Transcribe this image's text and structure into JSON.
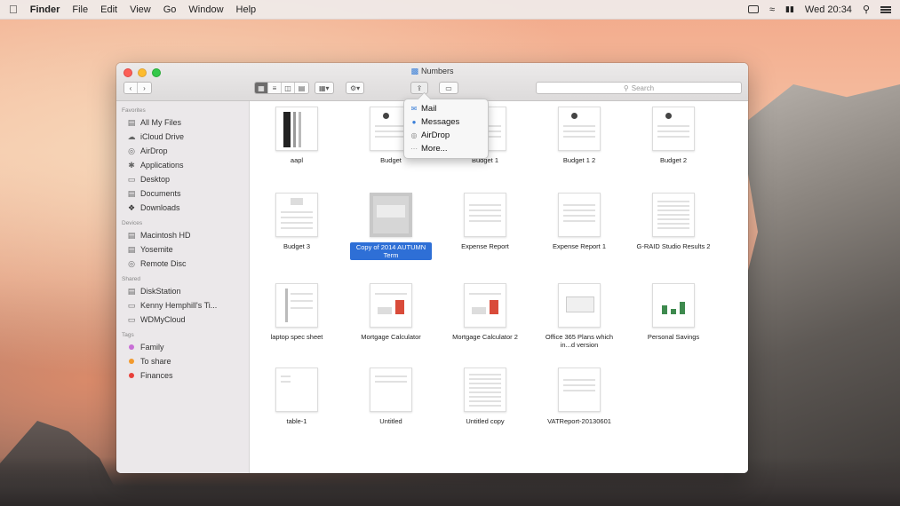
{
  "menubar": {
    "app_name": "Finder",
    "items": [
      "File",
      "Edit",
      "View",
      "Go",
      "Window",
      "Help"
    ],
    "clock": "Wed 20:34"
  },
  "window": {
    "title": "Numbers",
    "search_placeholder": "Search"
  },
  "sidebar": {
    "sections": [
      {
        "title": "Favorites",
        "items": [
          {
            "label": "All My Files",
            "icon": "all-files-icon"
          },
          {
            "label": "iCloud Drive",
            "icon": "cloud-icon"
          },
          {
            "label": "AirDrop",
            "icon": "airdrop-icon"
          },
          {
            "label": "Applications",
            "icon": "applications-icon"
          },
          {
            "label": "Desktop",
            "icon": "desktop-icon"
          },
          {
            "label": "Documents",
            "icon": "documents-icon"
          },
          {
            "label": "Downloads",
            "icon": "downloads-icon"
          }
        ]
      },
      {
        "title": "Devices",
        "items": [
          {
            "label": "Macintosh HD",
            "icon": "disk-icon"
          },
          {
            "label": "Yosemite",
            "icon": "disk-icon"
          },
          {
            "label": "Remote Disc",
            "icon": "disc-icon"
          }
        ]
      },
      {
        "title": "Shared",
        "items": [
          {
            "label": "DiskStation",
            "icon": "server-icon"
          },
          {
            "label": "Kenny Hemphill's Ti...",
            "icon": "server-icon"
          },
          {
            "label": "WDMyCloud",
            "icon": "server-icon"
          }
        ]
      },
      {
        "title": "Tags",
        "items": [
          {
            "label": "Family",
            "color": "#c86fd6"
          },
          {
            "label": "To share",
            "color": "#f29a2e"
          },
          {
            "label": "Finances",
            "color": "#e8403a"
          }
        ]
      }
    ]
  },
  "files": [
    {
      "name": "aapl"
    },
    {
      "name": "Budget"
    },
    {
      "name": "Budget 1"
    },
    {
      "name": "Budget 1 2"
    },
    {
      "name": "Budget 2"
    },
    {
      "name": "Budget 3"
    },
    {
      "name": "Copy of 2014 AUTUMN Term",
      "selected": true
    },
    {
      "name": "Expense Report"
    },
    {
      "name": "Expense Report 1"
    },
    {
      "name": "G-RAID Studio Results 2"
    },
    {
      "name": "laptop spec sheet"
    },
    {
      "name": "Mortgage Calculator"
    },
    {
      "name": "Mortgage Calculator 2"
    },
    {
      "name": "Office 365 Plans which in...d version"
    },
    {
      "name": "Personal Savings"
    },
    {
      "name": "table-1"
    },
    {
      "name": "Untitled"
    },
    {
      "name": "Untitled copy"
    },
    {
      "name": "VATReport-20130601"
    }
  ],
  "share_menu": {
    "items": [
      {
        "label": "Mail",
        "icon": "mail-icon"
      },
      {
        "label": "Messages",
        "icon": "messages-icon"
      },
      {
        "label": "AirDrop",
        "icon": "airdrop-icon"
      },
      {
        "label": "More...",
        "icon": "more-icon"
      }
    ]
  },
  "colors": {
    "selection": "#2e6fd6",
    "tag_family": "#c86fd6",
    "tag_to_share": "#f29a2e",
    "tag_finances": "#e8403a"
  }
}
